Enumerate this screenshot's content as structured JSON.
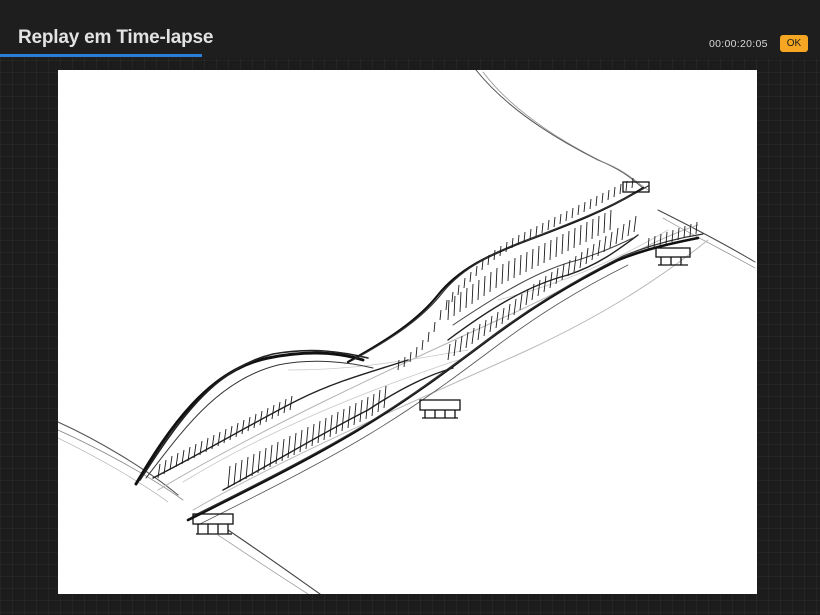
{
  "header": {
    "title": "Replay em Time-lapse",
    "elapsed_time": "00:00:20:05",
    "ok_label": "OK"
  },
  "colors": {
    "accent_underline": "#2b7fd9",
    "ok_button": "#f5a623",
    "background": "#1c1c1c"
  }
}
